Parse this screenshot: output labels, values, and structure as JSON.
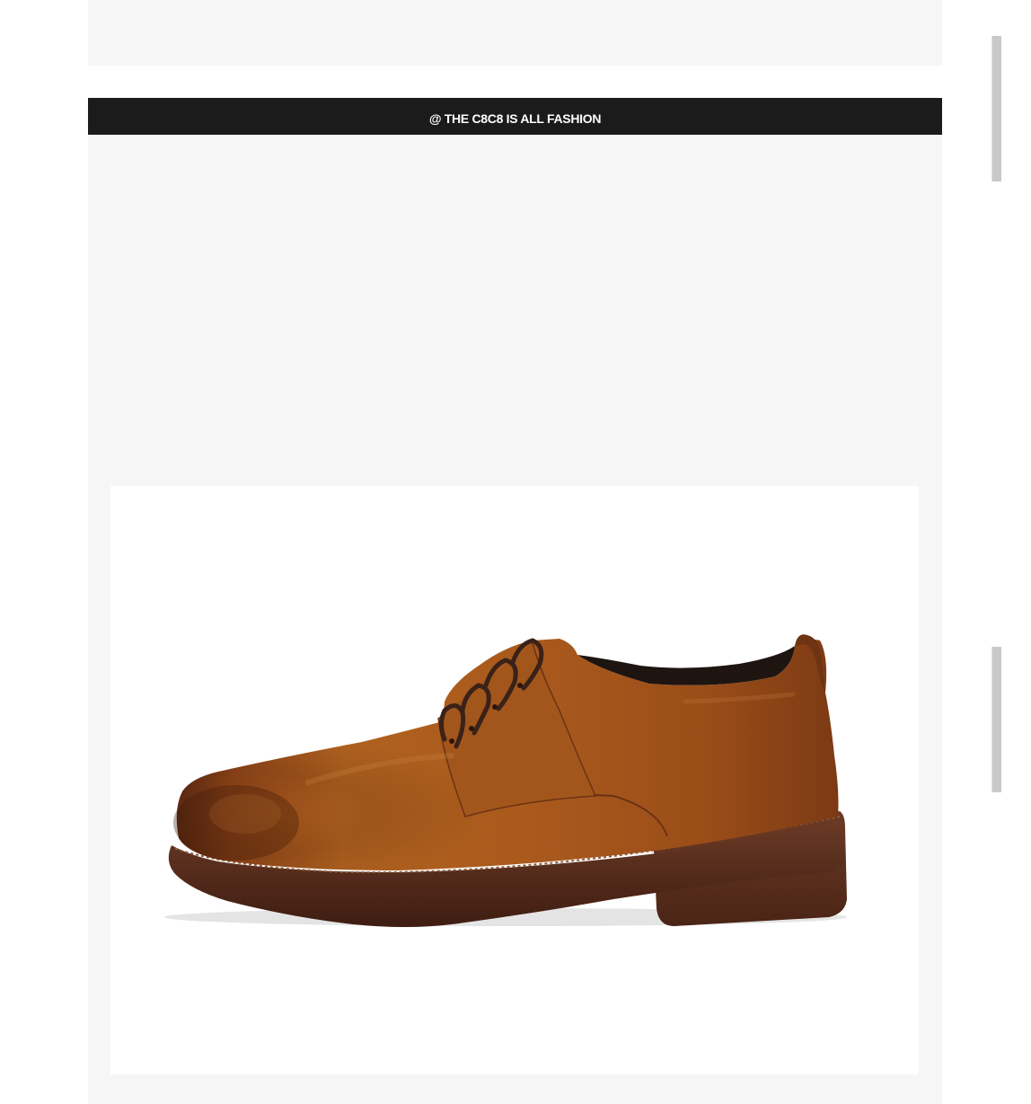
{
  "banner": {
    "text": "@ THE C8C8 IS ALL FASHION",
    "background": "#1b1b1b",
    "text_color": "#ffffff"
  },
  "product": {
    "image_subject": "brown leather derby lace-up shoe",
    "leather_color": "#9a4f1c",
    "sole_color": "#5a2e1e"
  },
  "colors": {
    "panel_background": "#f6f6f6",
    "card_background": "#ffffff",
    "scroll_indicator": "#c9c9c9"
  }
}
